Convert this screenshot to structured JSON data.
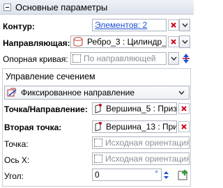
{
  "header": {
    "title": "Основные параметры"
  },
  "contour": {
    "label": "Контур:",
    "value": "Элементов: 2"
  },
  "guide": {
    "label": "Направляющая:",
    "value": "Ребро_3 : Цилиндр_1"
  },
  "support_curve": {
    "label": "Опорная кривая:",
    "placeholder": "По направляющей"
  },
  "section_control": {
    "title": "Управление сечением",
    "mode": "Фиксированное направление",
    "point_direction": {
      "label": "Точка/Направление:",
      "value": "Вершина_5 : Приз..."
    },
    "second_point": {
      "label": "Вторая точка:",
      "value": "Вершина_13 : При..."
    },
    "point": {
      "label": "Точка:",
      "placeholder": "Исходная ориентация"
    },
    "axis_x": {
      "label": "Ось X:",
      "placeholder": "Исходная ориентация"
    },
    "angle": {
      "label": "Угол:",
      "value": "0",
      "unit": "°"
    }
  },
  "colors": {
    "accent_red": "#d0021b",
    "link_blue": "#1d4fd6",
    "green_add": "#2e9e33"
  }
}
